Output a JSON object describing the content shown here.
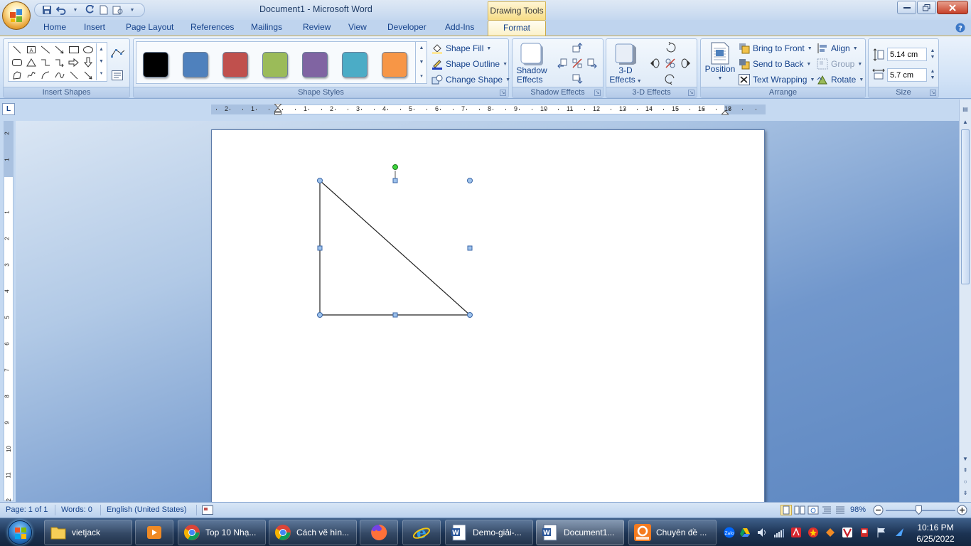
{
  "window": {
    "title": "Document1 - Microsoft Word",
    "contextual_tab_group": "Drawing Tools"
  },
  "tabs": [
    "Home",
    "Insert",
    "Page Layout",
    "References",
    "Mailings",
    "Review",
    "View",
    "Developer",
    "Add-Ins",
    "Format"
  ],
  "active_tab": "Format",
  "ribbon": {
    "groups": {
      "insert_shapes": "Insert Shapes",
      "shape_styles": "Shape Styles",
      "shadow_effects": "Shadow Effects",
      "three_d_effects": "3-D Effects",
      "arrange": "Arrange",
      "size": "Size"
    },
    "shape_style_colors": [
      "#000000",
      "#4f81bd",
      "#c0504d",
      "#9bbb59",
      "#8064a2",
      "#4bacc6",
      "#f79646"
    ],
    "shape_fill": "Shape Fill",
    "shape_outline": "Shape Outline",
    "change_shape": "Change Shape",
    "shadow_effects_line1": "Shadow",
    "shadow_effects_line2": "Effects",
    "three_d_line1": "3-D",
    "three_d_line2": "Effects",
    "position": "Position",
    "bring_to_front": "Bring to Front",
    "send_to_back": "Send to Back",
    "text_wrapping": "Text Wrapping",
    "align": "Align",
    "group": "Group",
    "rotate": "Rotate",
    "height_value": "5.14 cm",
    "width_value": "5.7 cm"
  },
  "ruler": {
    "horizontal_numbers": [
      "2",
      "1",
      "1",
      "2",
      "3",
      "4",
      "5",
      "6",
      "7",
      "8",
      "9",
      "10",
      "11",
      "12",
      "13",
      "14",
      "15",
      "16",
      "18"
    ],
    "vertical_numbers": [
      "2",
      "1",
      "1",
      "2",
      "3",
      "4",
      "5",
      "6",
      "7",
      "8",
      "9",
      "10",
      "11",
      "12"
    ]
  },
  "status": {
    "page": "Page: 1 of 1",
    "words": "Words: 0",
    "language": "English (United States)",
    "zoom": "98%"
  },
  "taskbar": {
    "items": [
      "vietjack",
      "Top 10 Nhạ...",
      "Cách vẽ hìn...",
      "Demo-giải-...",
      "Document1...",
      "Chuyên đề ..."
    ],
    "active_item": "Document1...",
    "time": "10:16 PM",
    "date": "6/25/2022"
  },
  "icons": {
    "office": "office-button-icon",
    "save": "save-icon",
    "undo": "undo-icon",
    "redo": "redo-icon",
    "new": "new-document-icon",
    "windows": "windows-start-icon"
  }
}
